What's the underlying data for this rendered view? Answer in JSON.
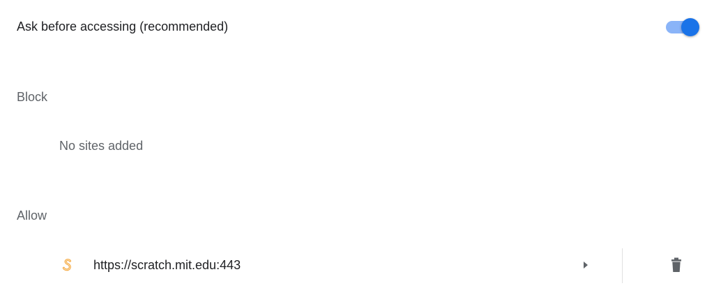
{
  "ask_setting": {
    "label": "Ask before accessing (recommended)",
    "enabled": true,
    "accent_color": "#1a73e8",
    "track_color": "#8ab4f8"
  },
  "block_section": {
    "heading": "Block",
    "empty_text": "No sites added"
  },
  "allow_section": {
    "heading": "Allow",
    "sites": [
      {
        "url": "https://scratch.mit.edu:443",
        "favicon": "scratch-favicon-icon",
        "favicon_color": "#f4a53a",
        "expand_icon": "arrow-right-icon",
        "delete_icon": "trash-icon"
      }
    ]
  }
}
